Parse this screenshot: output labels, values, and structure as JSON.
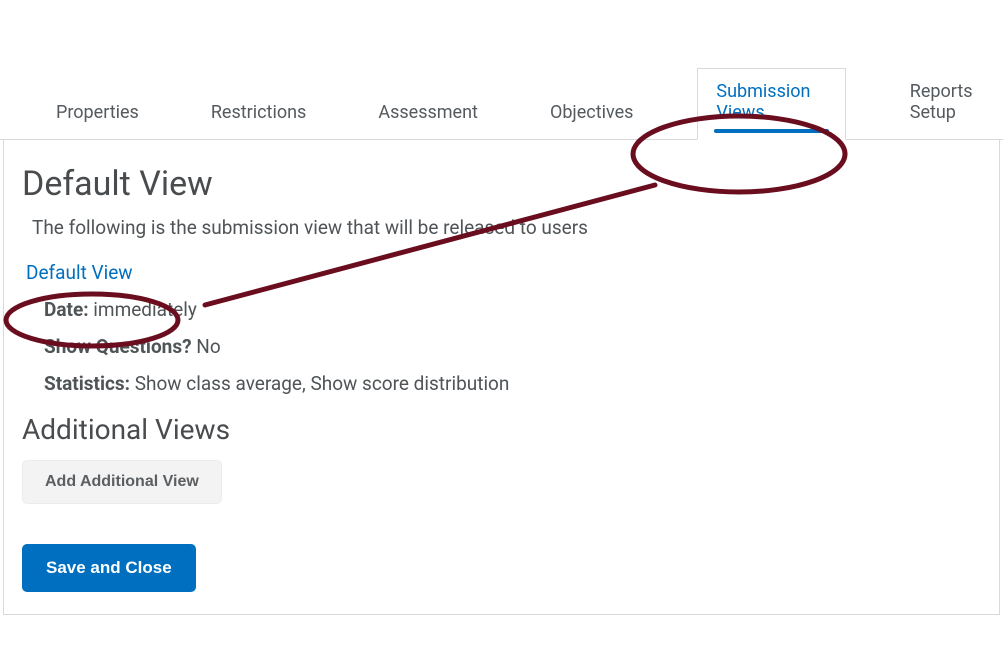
{
  "tabs": {
    "properties": "Properties",
    "restrictions": "Restrictions",
    "assessment": "Assessment",
    "objectives": "Objectives",
    "submission_views": "Submission Views",
    "reports_setup": "Reports Setup"
  },
  "page": {
    "heading_default_view": "Default View",
    "intro_text": "The following is the submission view that will be released to users",
    "default_view_link": "Default View",
    "date_label": "Date:",
    "date_value": "immediately",
    "questions_label": "Show Questions?",
    "questions_value": "No",
    "stats_label": "Statistics:",
    "stats_value": "Show class average, Show score distribution",
    "heading_additional": "Additional Views",
    "add_additional_btn": "Add Additional View",
    "save_btn": "Save and Close"
  }
}
